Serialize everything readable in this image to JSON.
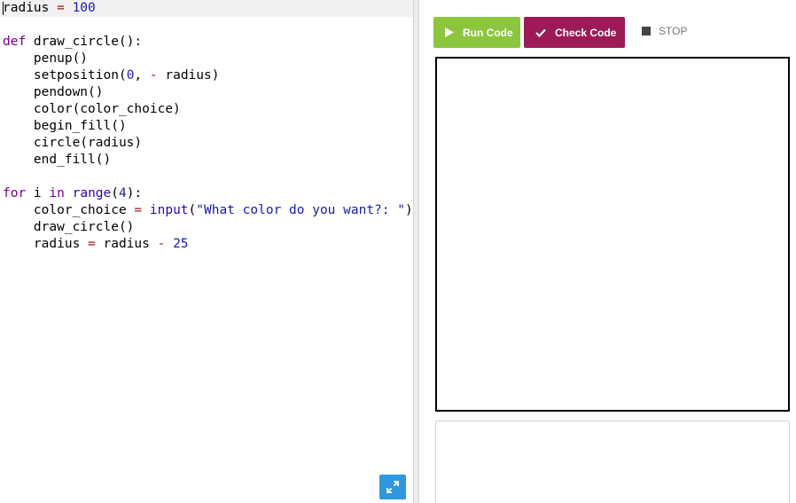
{
  "editor": {
    "lines": [
      [
        {
          "t": "radius ",
          "c": ""
        },
        {
          "t": "=",
          "c": "op"
        },
        {
          "t": " ",
          "c": ""
        },
        {
          "t": "100",
          "c": "num"
        }
      ],
      [],
      [
        {
          "t": "def",
          "c": "kw"
        },
        {
          "t": " draw_circle():",
          "c": ""
        }
      ],
      [
        {
          "t": "    penup()",
          "c": ""
        }
      ],
      [
        {
          "t": "    setposition(",
          "c": ""
        },
        {
          "t": "0",
          "c": "num"
        },
        {
          "t": ", ",
          "c": ""
        },
        {
          "t": "-",
          "c": "op"
        },
        {
          "t": " radius)",
          "c": ""
        }
      ],
      [
        {
          "t": "    pendown()",
          "c": ""
        }
      ],
      [
        {
          "t": "    color(color_choice)",
          "c": ""
        }
      ],
      [
        {
          "t": "    begin_fill()",
          "c": ""
        }
      ],
      [
        {
          "t": "    circle(radius)",
          "c": ""
        }
      ],
      [
        {
          "t": "    end_fill()",
          "c": ""
        }
      ],
      [],
      [
        {
          "t": "for",
          "c": "kw"
        },
        {
          "t": " i ",
          "c": ""
        },
        {
          "t": "in",
          "c": "kw"
        },
        {
          "t": " ",
          "c": ""
        },
        {
          "t": "range",
          "c": "builtin"
        },
        {
          "t": "(",
          "c": ""
        },
        {
          "t": "4",
          "c": "num"
        },
        {
          "t": "):",
          "c": ""
        }
      ],
      [
        {
          "t": "    color_choice ",
          "c": ""
        },
        {
          "t": "=",
          "c": "op"
        },
        {
          "t": " ",
          "c": ""
        },
        {
          "t": "input",
          "c": "builtin"
        },
        {
          "t": "(",
          "c": ""
        },
        {
          "t": "\"What color do you want?: \"",
          "c": "str"
        },
        {
          "t": ")",
          "c": ""
        }
      ],
      [
        {
          "t": "    draw_circle()",
          "c": ""
        }
      ],
      [
        {
          "t": "    radius ",
          "c": ""
        },
        {
          "t": "=",
          "c": "op"
        },
        {
          "t": " radius ",
          "c": ""
        },
        {
          "t": "-",
          "c": "op"
        },
        {
          "t": " ",
          "c": ""
        },
        {
          "t": "25",
          "c": "num"
        }
      ]
    ],
    "active_line": 0,
    "expand_icon": "expand-arrows-icon"
  },
  "toolbar": {
    "run_label": "Run Code",
    "check_label": "Check Code",
    "stop_label": "STOP",
    "run_color": "#8cc63e",
    "check_color": "#9c1b57"
  }
}
